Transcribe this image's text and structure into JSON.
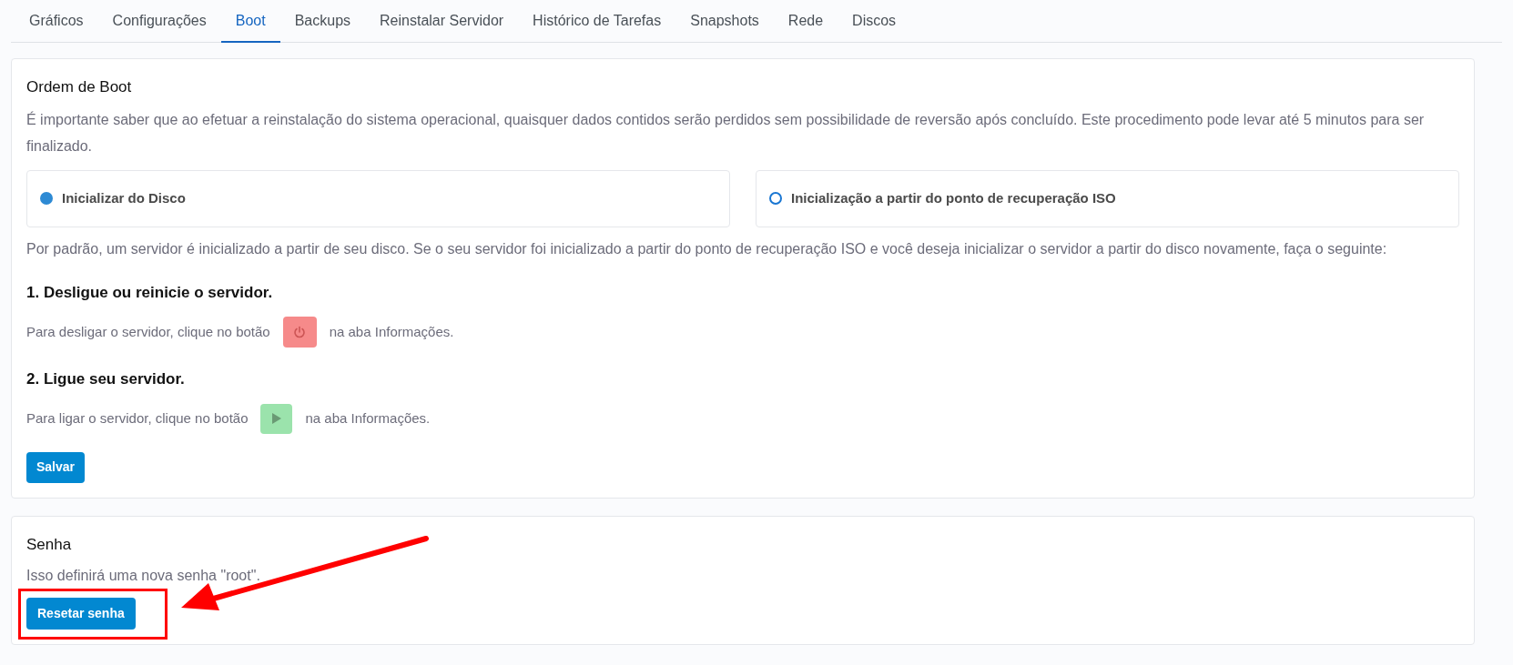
{
  "tabs": [
    {
      "label": "Gráficos",
      "selected": false
    },
    {
      "label": "Configurações",
      "selected": false
    },
    {
      "label": "Boot",
      "selected": true
    },
    {
      "label": "Backups",
      "selected": false
    },
    {
      "label": "Reinstalar Servidor",
      "selected": false
    },
    {
      "label": "Histórico de Tarefas",
      "selected": false
    },
    {
      "label": "Snapshots",
      "selected": false
    },
    {
      "label": "Rede",
      "selected": false
    },
    {
      "label": "Discos",
      "selected": false
    }
  ],
  "boot_order": {
    "title": "Ordem de Boot",
    "description": "É importante saber que ao efetuar a reinstalação do sistema operacional, quaisquer dados contidos serão perdidos sem possibilidade de reversão após concluído. Este procedimento pode levar até 5 minutos para ser finalizado.",
    "options": [
      {
        "label": "Inicializar do Disco",
        "selected": true
      },
      {
        "label": "Inicialização a partir do ponto de recuperação ISO",
        "selected": false
      }
    ],
    "note": "Por padrão, um servidor é inicializado a partir de seu disco. Se o seu servidor foi inicializado a partir do ponto de recuperação ISO e você deseja inicializar o servidor a partir do disco novamente, faça o seguinte:",
    "steps": [
      {
        "heading": "1. Desligue ou reinicie o servidor.",
        "before": "Para desligar o servidor, clique no botão",
        "kind": "power",
        "after": "na aba Informações."
      },
      {
        "heading": "2. Ligue seu servidor.",
        "before": "Para ligar o servidor, clique no botão",
        "kind": "play",
        "after": "na aba Informações."
      }
    ],
    "button": "Salvar"
  },
  "password": {
    "title": "Senha",
    "description": "Isso definirá uma nova senha \"root\".",
    "button": "Resetar senha"
  }
}
